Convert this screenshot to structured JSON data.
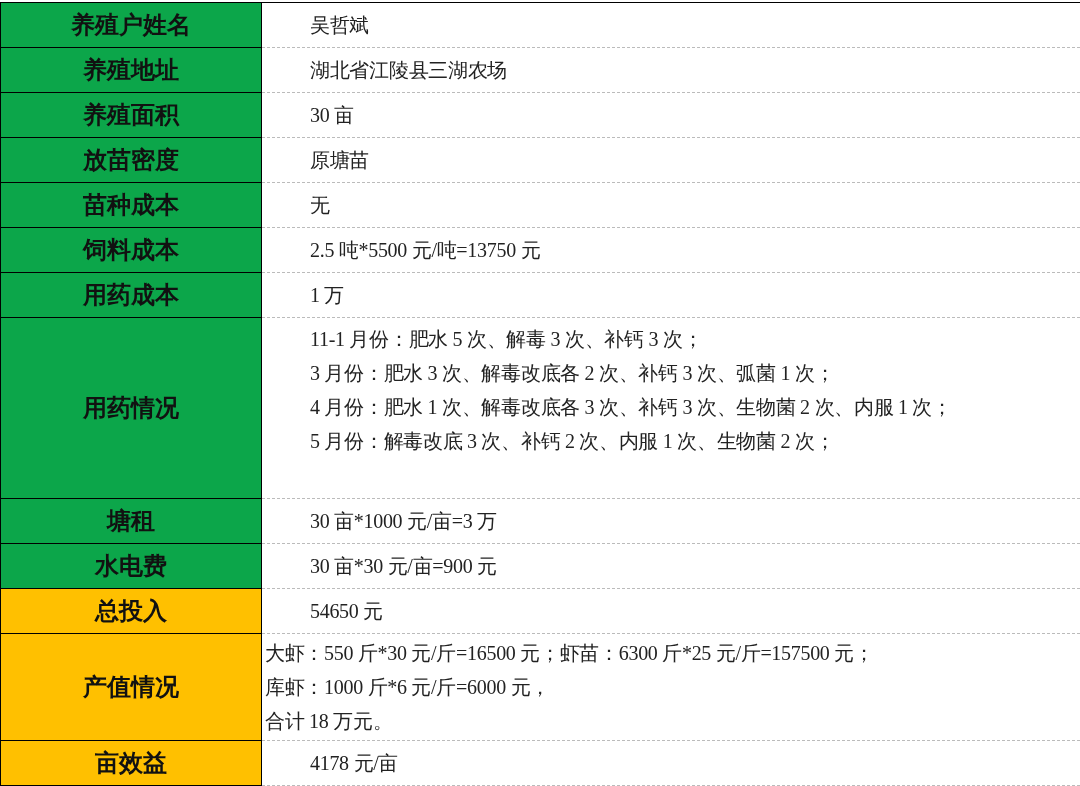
{
  "rows": [
    {
      "label": "养殖户姓名",
      "color": "#0ca64a",
      "kind": "single",
      "lines": [
        "吴哲斌"
      ]
    },
    {
      "label": "养殖地址",
      "color": "#0ca64a",
      "kind": "single",
      "lines": [
        "湖北省江陵县三湖农场"
      ]
    },
    {
      "label": "养殖面积",
      "color": "#0ca64a",
      "kind": "single",
      "lines": [
        "30 亩"
      ]
    },
    {
      "label": "放苗密度",
      "color": "#0ca64a",
      "kind": "single",
      "lines": [
        "原塘苗"
      ]
    },
    {
      "label": "苗种成本",
      "color": "#0ca64a",
      "kind": "single",
      "lines": [
        "无"
      ]
    },
    {
      "label": "饲料成本",
      "color": "#0ca64a",
      "kind": "single",
      "lines": [
        "2.5 吨*5500 元/吨=13750 元"
      ]
    },
    {
      "label": "用药成本",
      "color": "#0ca64a",
      "kind": "single",
      "lines": [
        "1 万"
      ]
    },
    {
      "label": "用药情况",
      "color": "#0ca64a",
      "kind": "list",
      "lines": [
        "11-1 月份：肥水 5 次、解毒 3 次、补钙 3 次；",
        "3 月份：肥水 3 次、解毒改底各 2 次、补钙 3 次、弧菌 1 次；",
        "4 月份：肥水 1 次、解毒改底各 3 次、补钙 3 次、生物菌 2 次、内服 1 次；",
        "5 月份：解毒改底 3 次、补钙 2 次、内服 1 次、生物菌 2 次；"
      ]
    },
    {
      "label": "塘租",
      "color": "#0ca64a",
      "kind": "single",
      "lines": [
        "30 亩*1000 元/亩=3 万"
      ]
    },
    {
      "label": "水电费",
      "color": "#0ca64a",
      "kind": "single",
      "lines": [
        "30 亩*30 元/亩=900 元"
      ]
    },
    {
      "label": "总投入",
      "color": "#ffc000",
      "kind": "single",
      "lines": [
        "54650 元"
      ]
    },
    {
      "label": "产值情况",
      "color": "#ffc000",
      "kind": "flush",
      "lines": [
        "大虾：550 斤*30 元/斤=16500 元；虾苗：6300 斤*25 元/斤=157500 元；",
        "库虾：1000 斤*6 元/斤=6000 元，",
        "合计 18 万元。"
      ]
    },
    {
      "label": "亩效益",
      "color": "#ffc000",
      "kind": "single",
      "lines": [
        "4178 元/亩"
      ]
    }
  ]
}
